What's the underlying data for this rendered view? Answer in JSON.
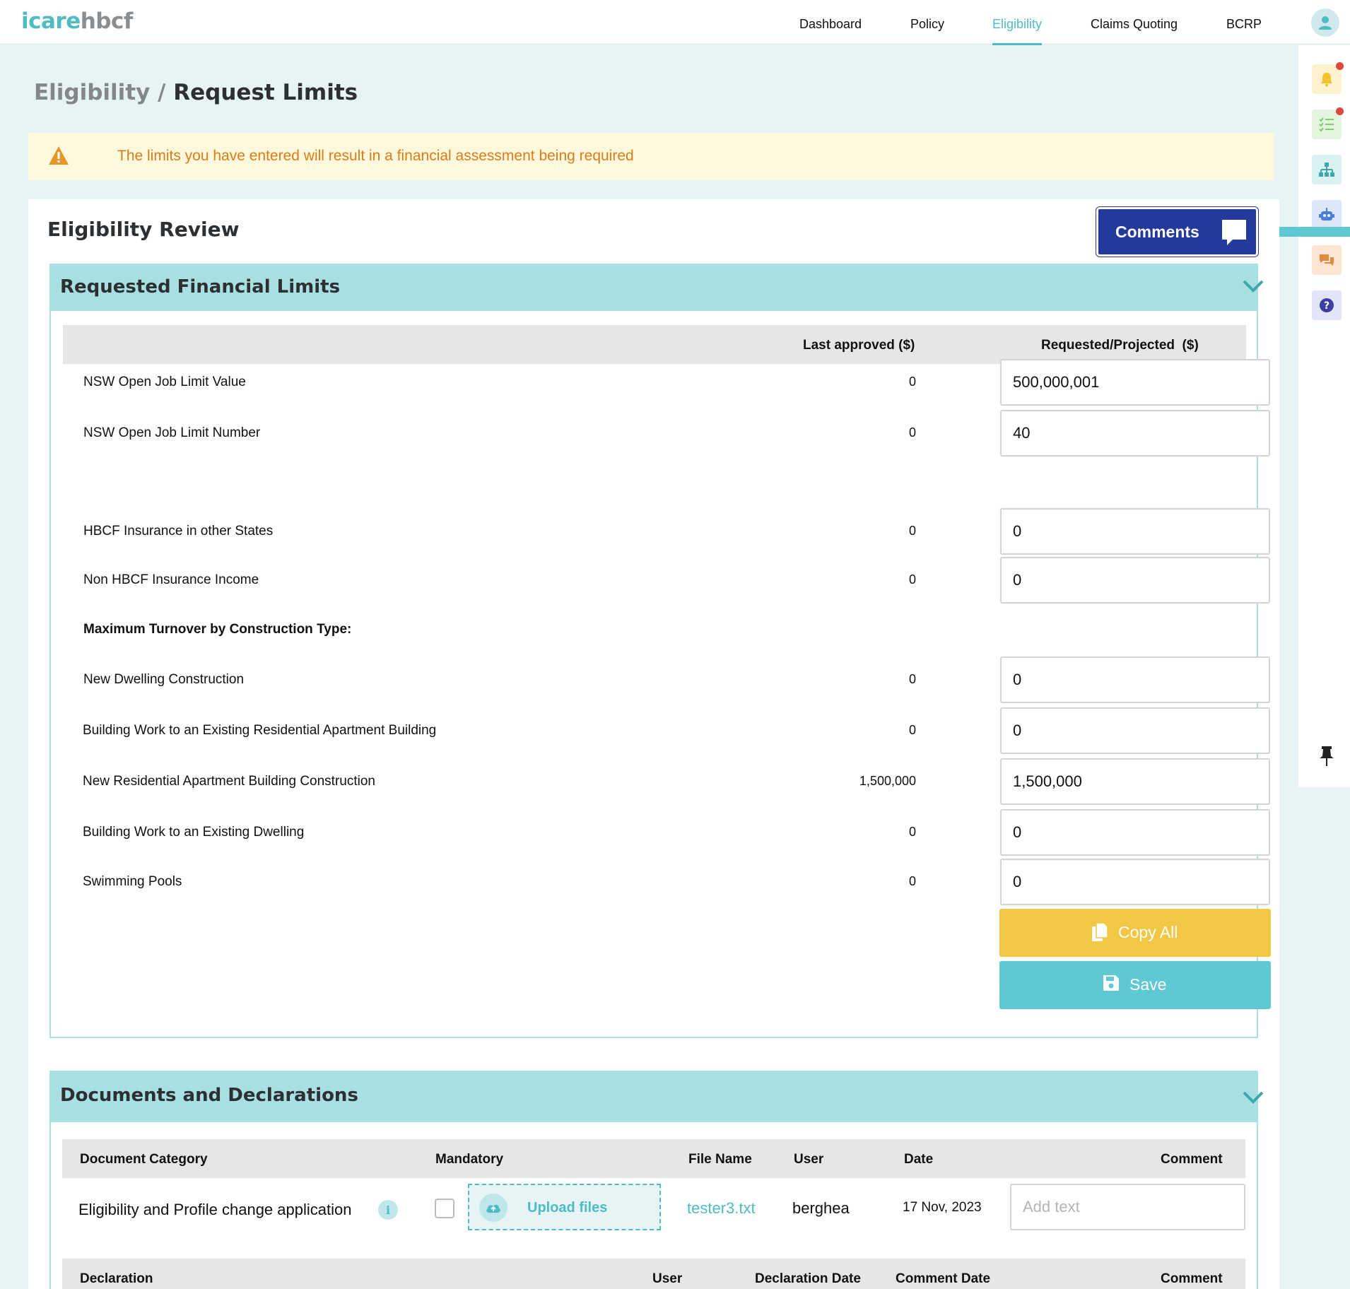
{
  "brand": {
    "part1": "icare",
    "part2": "hbcf"
  },
  "nav": {
    "items": [
      {
        "label": "Dashboard"
      },
      {
        "label": "Policy"
      },
      {
        "label": "Eligibility"
      },
      {
        "label": "Claims Quoting"
      },
      {
        "label": "BCRP"
      }
    ],
    "active": "Eligibility"
  },
  "rail": {
    "items": [
      "bell-icon",
      "checklist-icon",
      "org-chart-icon",
      "robot-icon",
      "chat-icon",
      "help-icon"
    ],
    "pin": "pin-icon"
  },
  "breadcrumb": {
    "parent": "Eligibility /",
    "current": "Request Limits"
  },
  "alert": {
    "text": "The limits you have entered will result in a financial assessment being required"
  },
  "review": {
    "title": "Eligibility Review",
    "comments_label": "Comments"
  },
  "limits": {
    "title": "Requested Financial Limits",
    "col_last": "Last approved ($)",
    "col_requested": "Requested/Projected  ($)",
    "rows": [
      {
        "label": "NSW Open Job Limit Value",
        "last": "0",
        "requested": "500,000,001"
      },
      {
        "label": "NSW Open Job Limit Number",
        "last": "0",
        "requested": "40"
      },
      {
        "label": "HBCF Insurance in other States",
        "last": "0",
        "requested": "0"
      },
      {
        "label": "Non HBCF Insurance Income",
        "last": "0",
        "requested": "0"
      }
    ],
    "turnover_heading": "Maximum Turnover by Construction Type:",
    "turnover_rows": [
      {
        "label": "New Dwelling Construction",
        "last": "0",
        "requested": "0"
      },
      {
        "label": "Building Work to an Existing Residential Apartment Building",
        "last": "0",
        "requested": "0"
      },
      {
        "label": "New Residential Apartment Building Construction",
        "last": "1,500,000",
        "requested": "1,500,000"
      },
      {
        "label": "Building Work to an Existing Dwelling",
        "last": "0",
        "requested": "0"
      },
      {
        "label": "Swimming Pools",
        "last": "0",
        "requested": "0"
      }
    ],
    "copy_all_label": "Copy All",
    "save_label": "Save"
  },
  "documents": {
    "title": "Documents and Declarations",
    "headers": {
      "category": "Document Category",
      "mandatory": "Mandatory",
      "file_name": "File Name",
      "user": "User",
      "date": "Date",
      "comment": "Comment"
    },
    "rows": [
      {
        "category": "Eligibility and Profile change application",
        "upload_label": "Upload files",
        "file_name": "tester3.txt",
        "user": "berghea",
        "date": "17 Nov, 2023",
        "comment_placeholder": "Add text"
      }
    ],
    "declaration_headers": {
      "declaration": "Declaration",
      "user": "User",
      "declaration_date": "Declaration Date",
      "comment_date": "Comment Date",
      "comment": "Comment"
    }
  },
  "colors": {
    "accent": "#4fbcc4",
    "panel_header": "#a8dfe0",
    "comments_button": "#23399c",
    "copy_button": "#f2c744",
    "save_button": "#5ec9d4",
    "alert_bg": "#fef9dc",
    "alert_text": "#de7b18"
  }
}
